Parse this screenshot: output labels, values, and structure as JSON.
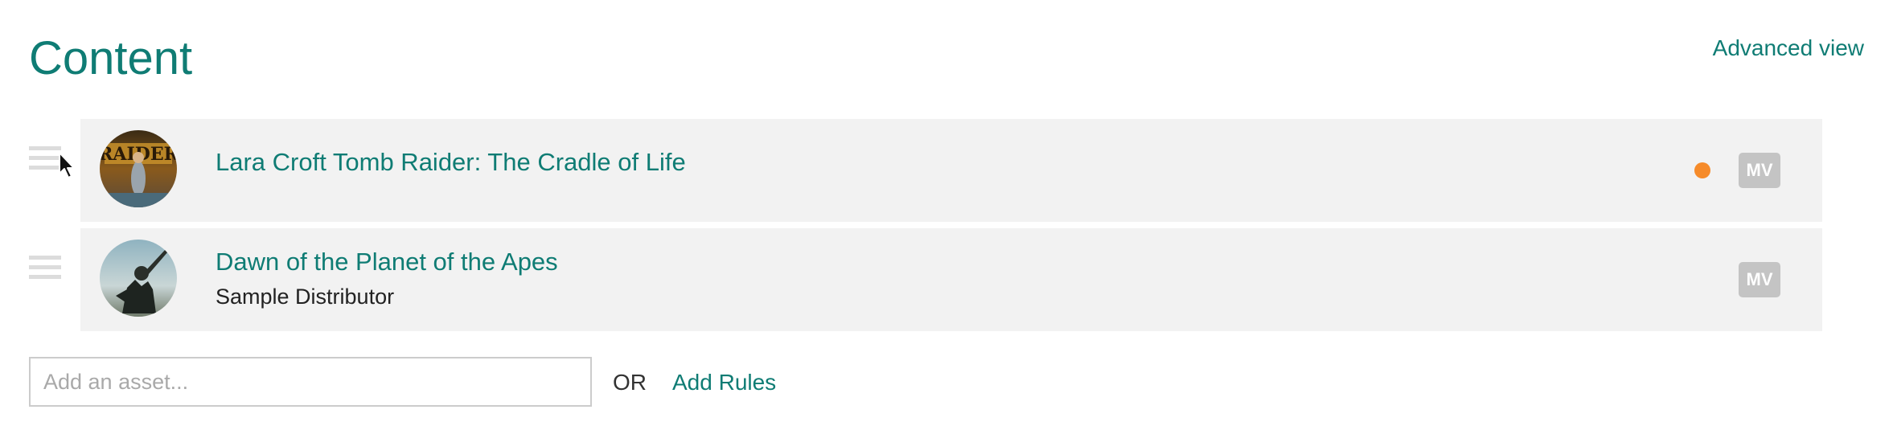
{
  "header": {
    "title": "Content",
    "advanced_link": "Advanced view"
  },
  "items": [
    {
      "title": "Lara Croft Tomb Raider: The Cradle of Life",
      "subtitle": "",
      "status_color": "#f68b2a",
      "badge": "MV",
      "thumbnail": "tomb-raider-poster"
    },
    {
      "title": "Dawn of the Planet of the Apes",
      "subtitle": "Sample Distributor",
      "badge": "MV",
      "thumbnail": "planet-of-the-apes-poster"
    }
  ],
  "add_asset": {
    "placeholder": "Add an asset...",
    "value": "",
    "or_label": "OR",
    "add_rules_label": "Add Rules"
  },
  "colors": {
    "accent": "#0f7c74",
    "row_background": "#f2f2f2",
    "status_orange": "#f68b2a",
    "badge_gray": "#c4c4c4"
  }
}
